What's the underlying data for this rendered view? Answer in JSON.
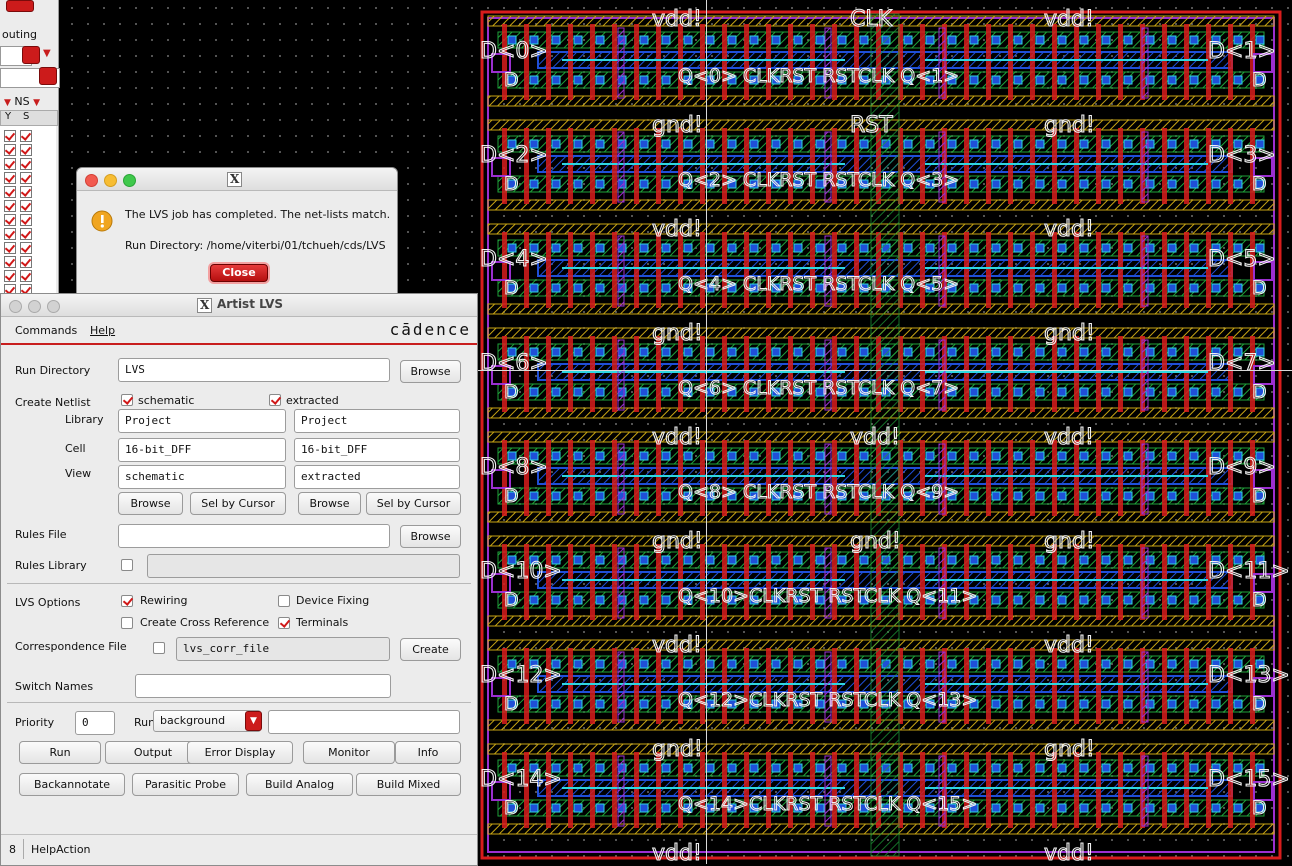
{
  "layout": {
    "top_labels": {
      "vdd_left": "vdd!",
      "clk": "CLK",
      "vdd_right": "vdd!"
    },
    "rows": [
      {
        "d_left": "D<0>",
        "d_right": "D<1>",
        "center_text": "Q<0> CLKRST RSTCLK  Q<1>",
        "below_left": "gnd!",
        "below_mid": "RST",
        "below_right": "gnd!"
      },
      {
        "d_left": "D<2>",
        "d_right": "D<3>",
        "center_text": "Q<2> CLKRST RSTCLK  Q<3>",
        "below_left": "vdd!",
        "below_mid": "",
        "below_right": "vdd!"
      },
      {
        "d_left": "D<4>",
        "d_right": "D<5>",
        "center_text": "Q<4> CLKRST RSTCLK  Q<5>",
        "below_left": "gnd!",
        "below_mid": "",
        "below_right": "gnd!"
      },
      {
        "d_left": "D<6>",
        "d_right": "D<7>",
        "center_text": "Q<6> CLKRST RSTCLK  Q<7>",
        "below_left": "vdd!",
        "below_mid": "vdd!",
        "below_right": "vdd!"
      },
      {
        "d_left": "D<8>",
        "d_right": "D<9>",
        "center_text": "Q<8> CLKRST RSTCLK  Q<9>",
        "below_left": "gnd!",
        "below_mid": "gnd!",
        "below_right": "gnd!"
      },
      {
        "d_left": "D<10>",
        "d_right": "D<11>",
        "center_text": "Q<10>CLKRST RSTCLK  Q<11>",
        "below_left": "vdd!",
        "below_mid": "",
        "below_right": "vdd!"
      },
      {
        "d_left": "D<12>",
        "d_right": "D<13>",
        "center_text": "Q<12>CLKRST RSTCLK  Q<13>",
        "below_left": "gnd!",
        "below_mid": "",
        "below_right": "gnd!"
      },
      {
        "d_left": "D<14>",
        "d_right": "D<15>",
        "center_text": "Q<14>CLKRST RSTCLK  Q<15>",
        "below_left": "vdd!",
        "below_mid": "",
        "below_right": "vdd!"
      }
    ],
    "colors": {
      "metal1": "#1f4fd8",
      "poly": "#d81c1c",
      "diff": "#1fa23a",
      "via": "#9b2fd0",
      "contact": "#2fd6e0",
      "nwell": "#c7a414",
      "label": "#f2f2f2"
    }
  },
  "strip": {
    "routing_label": "outing",
    "ns_label": "NS",
    "col_s": "S",
    "col_y": "Y"
  },
  "popup": {
    "message_line1": "The LVS job has completed. The net-lists match.",
    "message_line2": "Run Directory: /home/viterbi/01/tchueh/cds/LVS",
    "close_label": "Close",
    "icon": "warning-icon"
  },
  "lvs_form": {
    "title": "Artist LVS",
    "menu": {
      "commands": "Commands",
      "help": "Help",
      "brand": "cādence"
    },
    "run_directory": {
      "label": "Run Directory",
      "value": "LVS",
      "browse": "Browse"
    },
    "create_netlist": {
      "label": "Create Netlist",
      "schematic_label": "schematic",
      "extracted_label": "extracted",
      "library_label": "Library",
      "cell_label": "Cell",
      "view_label": "View",
      "left": {
        "library": "Project",
        "cell": "16-bit_DFF",
        "view": "schematic"
      },
      "right": {
        "library": "Project",
        "cell": "16-bit_DFF",
        "view": "extracted"
      },
      "browse": "Browse",
      "sel_by_cursor": "Sel by Cursor"
    },
    "rules_file": {
      "label": "Rules File",
      "value": "",
      "browse": "Browse"
    },
    "rules_library": {
      "label": "Rules Library",
      "value": ""
    },
    "lvs_options": {
      "label": "LVS Options",
      "rewiring": "Rewiring",
      "device_fixing": "Device Fixing",
      "cross_reference": "Create Cross Reference",
      "terminals": "Terminals"
    },
    "correspondence": {
      "label": "Correspondence File",
      "value": "lvs_corr_file",
      "create": "Create"
    },
    "switch_names": {
      "label": "Switch Names",
      "value": ""
    },
    "priority": {
      "label": "Priority",
      "value": "0",
      "run_label": "Run",
      "run_mode": "background",
      "run_extra": ""
    },
    "buttons_row1": [
      "Run",
      "Output",
      "Error Display",
      "Monitor",
      "Info"
    ],
    "buttons_row2": [
      "Backannotate",
      "Parasitic Probe",
      "Build Analog",
      "Build Mixed"
    ],
    "status": {
      "number": "8",
      "text": "HelpAction"
    }
  }
}
